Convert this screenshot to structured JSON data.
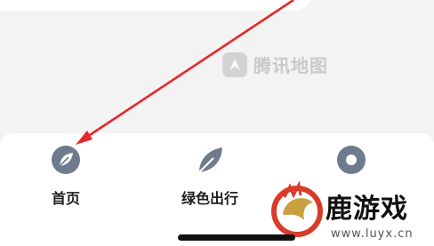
{
  "map": {
    "watermark_text": "腾讯地图",
    "watermark_icon": "compass-icon"
  },
  "tab_bar": {
    "tabs": [
      {
        "label": "首页",
        "icon": "leaf-circle-icon"
      },
      {
        "label": "绿色出行",
        "icon": "leaf-icon"
      },
      {
        "label": "",
        "icon": "location-pin-icon"
      }
    ]
  },
  "annotation": {
    "arrow_color": "#e8262a"
  },
  "site_logo": {
    "name": "鹿游戏",
    "url": "www.luyx.cn",
    "accent": "#d93a2b"
  },
  "colors": {
    "icon_gray": "#6e7b8c",
    "tab_label": "#1e1e1e"
  }
}
